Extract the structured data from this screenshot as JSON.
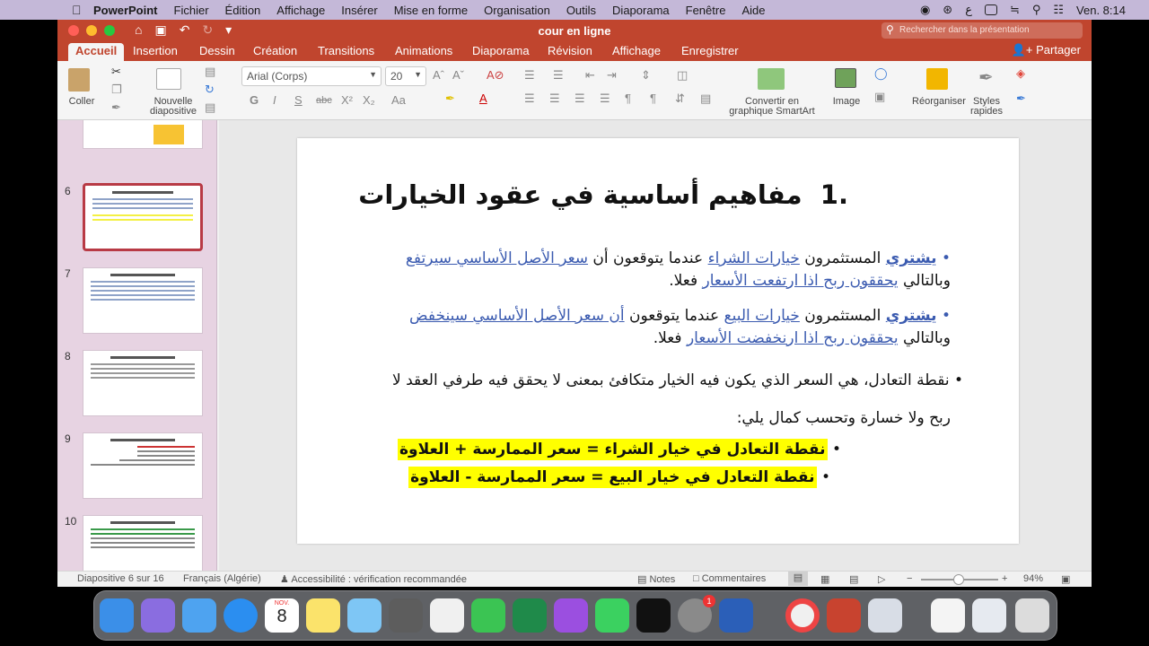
{
  "menubar": {
    "app": "PowerPoint",
    "items": [
      "Fichier",
      "Édition",
      "Affichage",
      "Insérer",
      "Mise en forme",
      "Organisation",
      "Outils",
      "Diaporama",
      "Fenêtre",
      "Aide"
    ],
    "clock": "Ven. 8:14"
  },
  "window": {
    "title": "cour en ligne",
    "search_placeholder": "Rechercher dans la présentation",
    "share": "Partager"
  },
  "tabs": [
    "Accueil",
    "Insertion",
    "Dessin",
    "Création",
    "Transitions",
    "Animations",
    "Diaporama",
    "Révision",
    "Affichage",
    "Enregistrer"
  ],
  "ribbon": {
    "paste": "Coller",
    "new_slide_1": "Nouvelle",
    "new_slide_2": "diapositive",
    "font": "Arial (Corps)",
    "size": "20",
    "smartart_1": "Convertir en",
    "smartart_2": "graphique SmartArt",
    "image": "Image",
    "arrange": "Réorganiser",
    "styles_1": "Styles",
    "styles_2": "rapides"
  },
  "thumbs": [
    "6",
    "7",
    "8",
    "9",
    "10"
  ],
  "slide": {
    "num": ".1",
    "title": "مفاهيم أساسية في عقود الخيارات",
    "b1": {
      "a": "يشتري",
      "b": " المستثمرون ",
      "c": "خيارات الشراء",
      "d": " عندما يتوقعون أن ",
      "e": "سعر الأصل الأساسي سيرتفع",
      "f": " وبالتالي ",
      "g": "يحققون ربح اذا ارتفعت الأسعار",
      "h": " فعلا."
    },
    "b2": {
      "a": "يشتري",
      "b": " المستثمرون ",
      "c": "خيارات البيع",
      "d": " عندما يتوقعون ",
      "e": "أن سعر الأصل الأساسي سينخفض",
      "f": " وبالتالي ",
      "g": "يحققون ربح اذا ارنخفضت الأسعار",
      "h": " فعلا."
    },
    "b3a": "نقطة التعادل، هي السعر الذي يكون فيه الخيار متكافئ بمعنى لا يحقق فيه طرفي العقد لا",
    "b3b": "ربح ولا خسارة وتحسب كمال يلي:",
    "f1": "نقطة التعادل في خيار الشراء = سعر الممارسة + العلاوة",
    "f2": "نقطة التعادل في خيار البيع = سعر الممارسة - العلاوة"
  },
  "status": {
    "slide": "Diapositive 6 sur 16",
    "lang": "Français (Algérie)",
    "access": "Accessibilité : vérification recommandée",
    "notes": "Notes",
    "comments": "Commentaires",
    "zoom": "94%"
  },
  "dock": {
    "calendar_month": "NOV.",
    "calendar_day": "8",
    "badge": "1"
  }
}
